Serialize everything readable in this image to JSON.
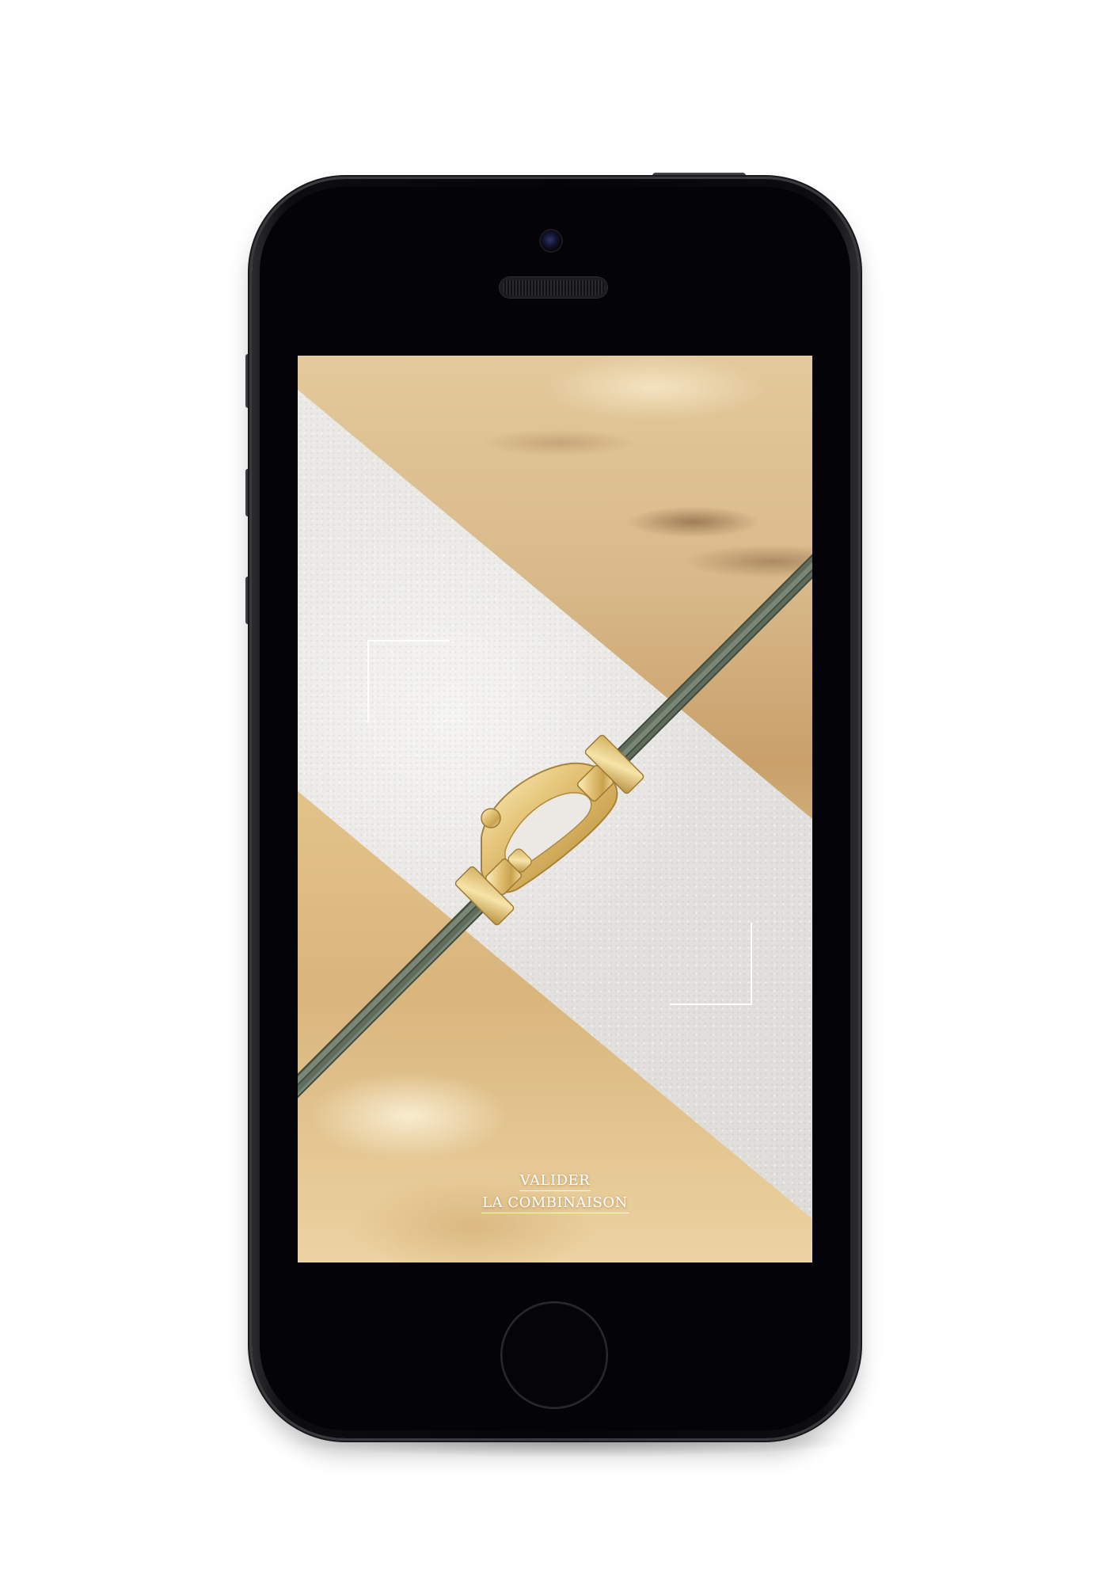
{
  "device": {
    "model": "phone-mockup",
    "frame_color": "#050508"
  },
  "screen": {
    "cta": {
      "line1": "VALIDER",
      "line2": "LA COMBINAISON"
    },
    "product": {
      "cable_color": "#5f6c5c",
      "clasp_color": "#e6c77c"
    },
    "frame_corners": [
      "corner-top-left",
      "corner-bottom-right"
    ]
  }
}
